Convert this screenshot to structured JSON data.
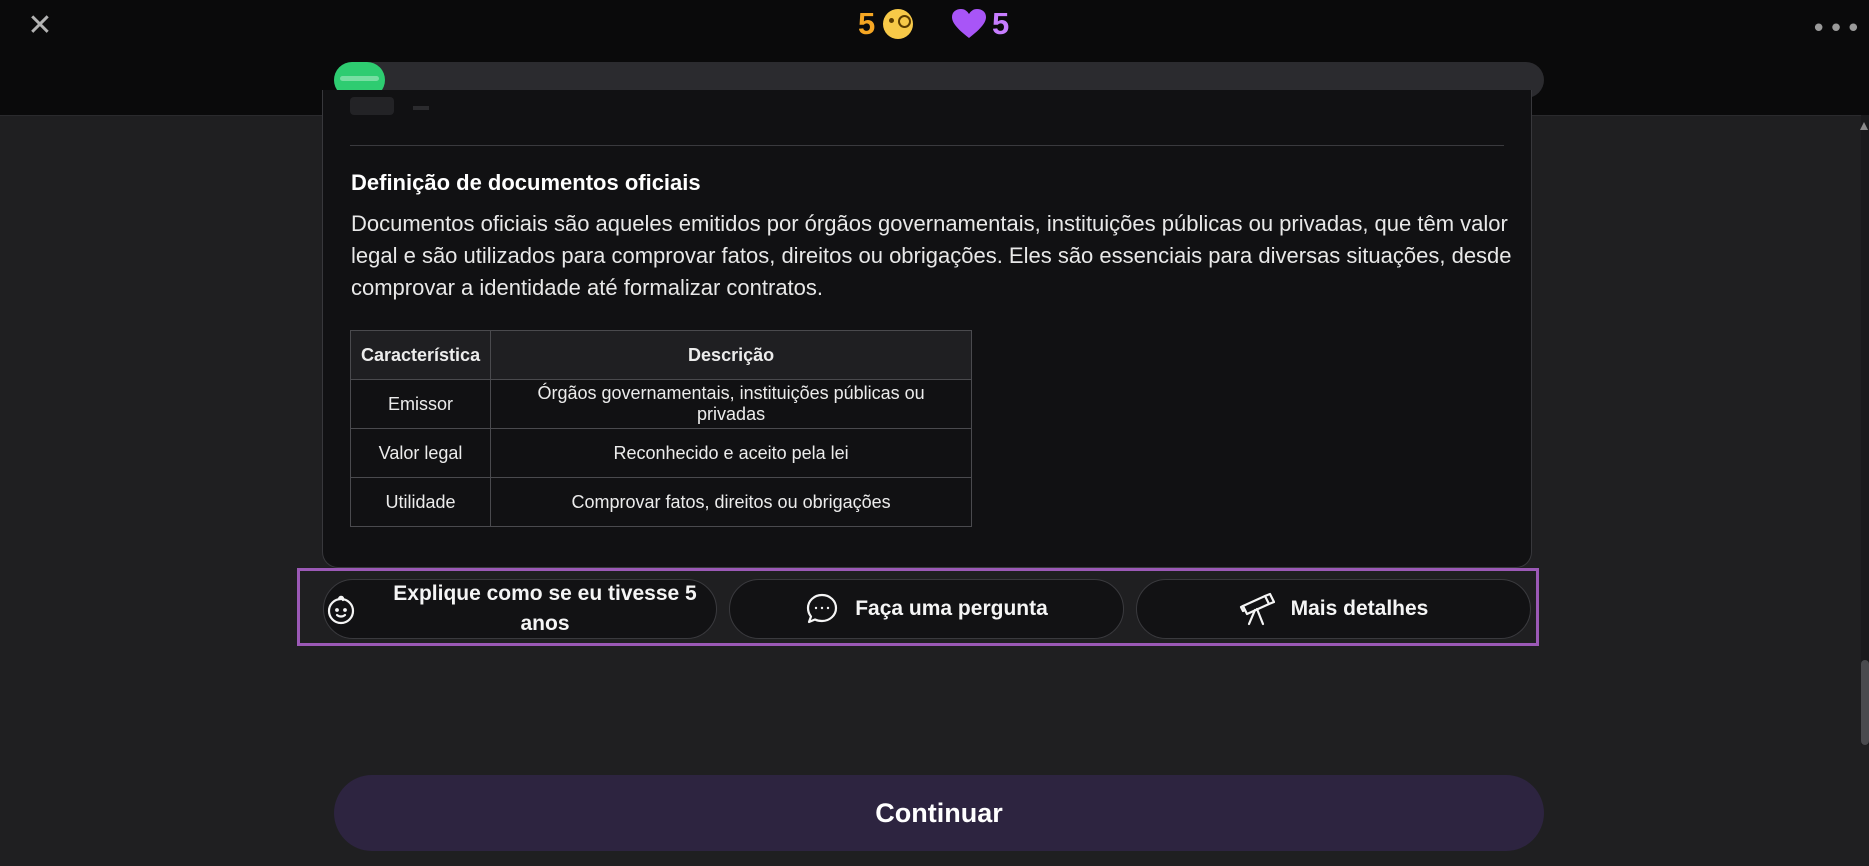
{
  "header": {
    "close_icon": "close-icon",
    "xp_value": "5",
    "xp_icon": "monocle-face-icon",
    "lives_value": "5",
    "lives_icon": "purple-heart-icon",
    "more_label": "•••",
    "more_icon": "more-options-icon",
    "progress_fraction": 0.042,
    "progress_color": "#2ecc71"
  },
  "lesson": {
    "heading": "Definição de documentos oficiais",
    "paragraph": "Documentos oficiais são aqueles emitidos por órgãos governamentais, instituições públicas ou privadas, que têm valor legal e são utilizados para comprovar fatos, direitos ou obrigações. Eles são essenciais para diversas situações, desde comprovar a identidade até formalizar contratos.",
    "table": {
      "headers": [
        "Característica",
        "Descrição"
      ],
      "rows": [
        [
          "Emissor",
          "Órgãos governamentais, instituições públicas ou privadas"
        ],
        [
          "Valor legal",
          "Reconhecido e aceito pela lei"
        ],
        [
          "Utilidade",
          "Comprovar fatos, direitos ou obrigações"
        ]
      ]
    }
  },
  "actions": {
    "eli5_label": "Explique como se eu tivesse 5 anos",
    "eli5_icon": "baby-face-icon",
    "ask_label": "Faça uma pergunta",
    "ask_icon": "chat-bubble-icon",
    "more_label": "Mais detalhes",
    "more_icon": "telescope-icon",
    "highlight_color": "#9b59b6"
  },
  "footer": {
    "continue_label": "Continuar"
  }
}
